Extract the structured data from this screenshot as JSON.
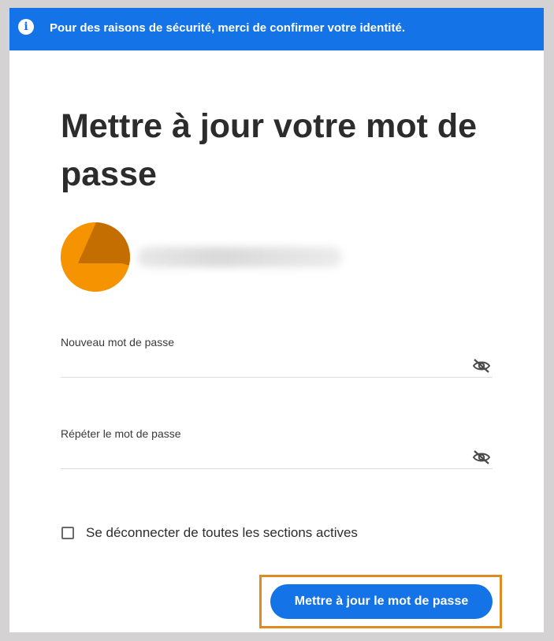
{
  "banner": {
    "icon": "info-icon",
    "message": "Pour des raisons de sécurité, merci de confirmer votre identité."
  },
  "page_title": "Mettre à jour votre mot de passe",
  "account": {
    "avatar_colors": {
      "outer": "#f59300",
      "inner": "#c46d00"
    },
    "email": ""
  },
  "fields": {
    "new_password": {
      "label": "Nouveau mot de passe",
      "value": "",
      "icon": "eye-hidden-icon"
    },
    "repeat_password": {
      "label": "Répéter le mot de passe",
      "value": "",
      "icon": "eye-hidden-icon"
    }
  },
  "sign_out_all": {
    "label": "Se déconnecter de toutes les sections actives",
    "checked": false
  },
  "submit_button": {
    "label": "Mettre à jour le mot de passe"
  },
  "colors": {
    "accent": "#1473e6",
    "highlight_border": "#e08a22",
    "background": "#d4d2d3"
  }
}
